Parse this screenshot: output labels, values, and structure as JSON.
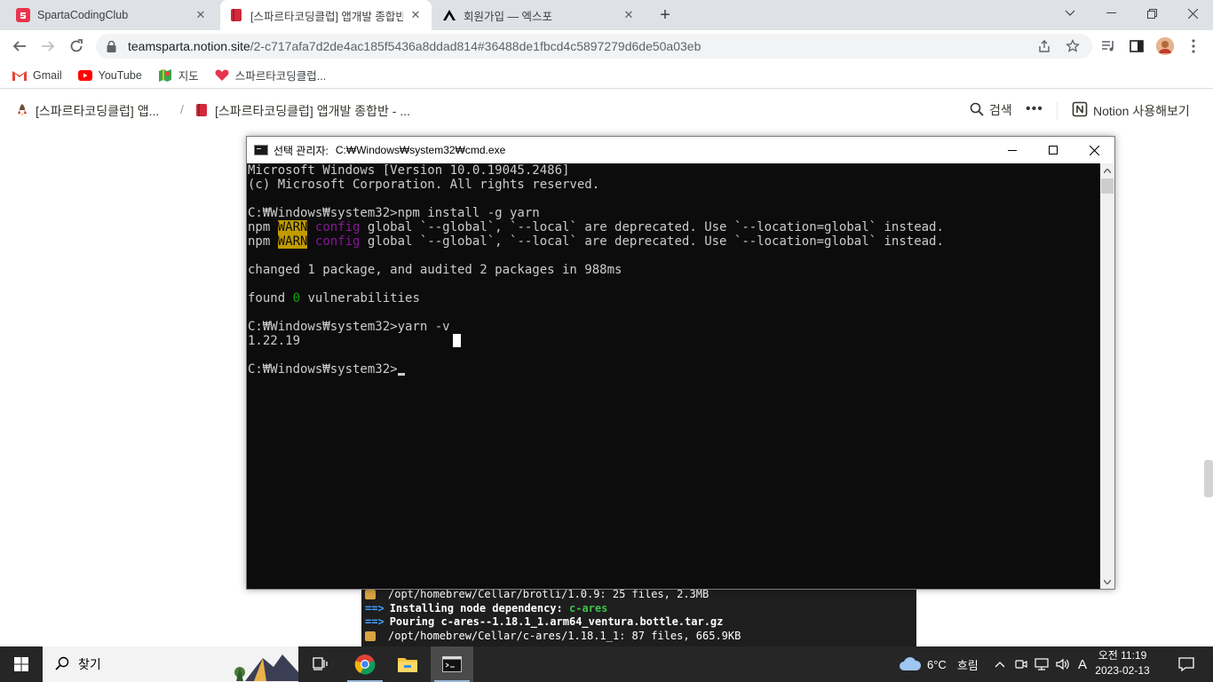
{
  "browser": {
    "tabs": [
      {
        "title": "SpartaCodingClub",
        "active": false
      },
      {
        "title": "[스파르타코딩클럽] 앱개발 종합반",
        "active": true
      },
      {
        "title": "회원가입 — 엑스포",
        "active": false
      }
    ],
    "url_host": "teamsparta.notion.site",
    "url_path": "/2-c717afa7d2de4ac185f5436a8ddad814#36488de1fbcd4c5897279d6de50a03eb",
    "bookmarks": [
      {
        "label": "Gmail"
      },
      {
        "label": "YouTube"
      },
      {
        "label": "지도"
      },
      {
        "label": "스파르타코딩클럽..."
      }
    ]
  },
  "notion": {
    "breadcrumb_1": "[스파르타코딩클럽] 앱...",
    "breadcrumb_sep": "/",
    "breadcrumb_2": "[스파르타코딩클럽] 앱개발 종합반 - ...",
    "search_label": "검색",
    "more_label": "•••",
    "try_label": "Notion 사용해보기"
  },
  "cmd": {
    "title_prefix": "선택 관리자:",
    "title_path": "C:₩Windows₩system32₩cmd.exe",
    "lines": {
      "l1": "Microsoft Windows [Version 10.0.19045.2486]",
      "l2": "(c) Microsoft Corporation. All rights reserved.",
      "l4": "C:₩Windows₩system32>npm install -g yarn",
      "npm": "npm",
      "warn": "WARN",
      "config": "config",
      "warn_rest": " global `--global`, `--local` are deprecated. Use `--location=global` instead.",
      "l8": "changed 1 package, and audited 2 packages in 988ms",
      "found_pre": "found ",
      "found_num": "0",
      "found_post": " vulnerabilities",
      "l12": "C:₩Windows₩system32>yarn -v",
      "l13": "1.22.19",
      "l15": "C:₩Windows₩system32>"
    }
  },
  "mac_terminal": {
    "line1": "/opt/homebrew/Cellar/brotli/1.0.9: 25 files, 2.3MB",
    "line2_label": "Installing node dependency:",
    "line2_value": "c-ares",
    "line3": "Pouring c-ares--1.18.1_1.arm64_ventura.bottle.tar.gz",
    "line4": "/opt/homebrew/Cellar/c-ares/1.18.1_1: 87 files, 665.9KB"
  },
  "taskbar": {
    "search_placeholder": "찾기",
    "weather_temp": "6°C",
    "weather_desc": "흐림",
    "ime": "A",
    "clock_period_time": "오전 11:19",
    "clock_date": "2023-02-13"
  },
  "colors": {
    "warn_bg": "#c19c00",
    "config_fg": "#881798",
    "zero_fg": "#13a10e"
  }
}
